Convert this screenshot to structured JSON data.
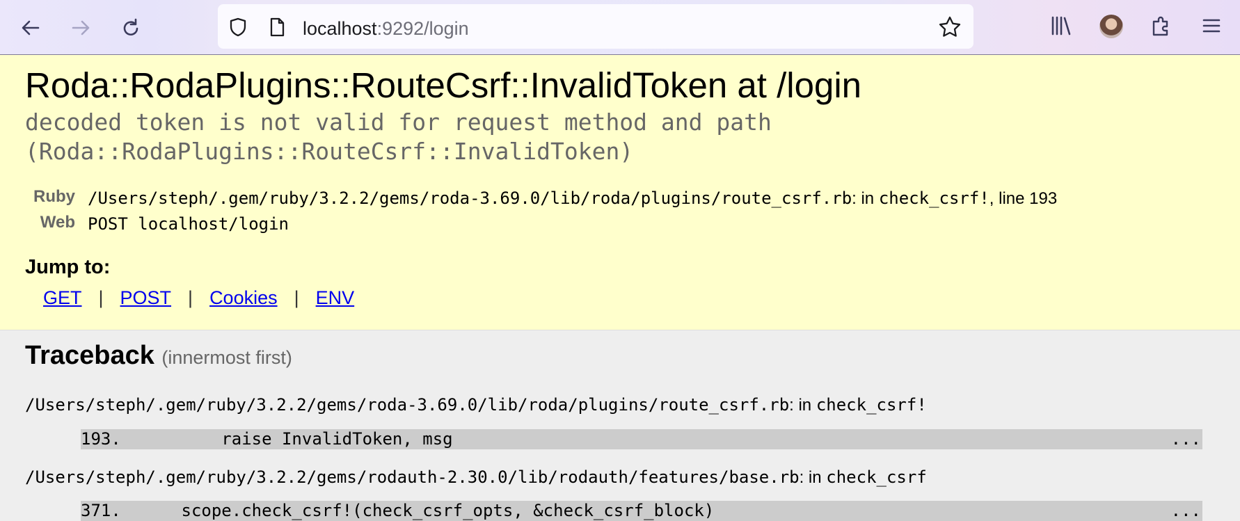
{
  "browser": {
    "url_host": "localhost",
    "url_rest": ":9292/login"
  },
  "error": {
    "title": "Roda::RodaPlugins::RouteCsrf::InvalidToken at /login",
    "message": "decoded token is not valid for request method and path\n(Roda::RodaPlugins::RouteCsrf::InvalidToken)",
    "ruby_label": "Ruby",
    "ruby_path": "/Users/steph/.gem/ruby/3.2.2/gems/roda-3.69.0/lib/roda/plugins/route_csrf.rb",
    "ruby_in": ": in ",
    "ruby_method": "check_csrf!",
    "ruby_line": ", line 193",
    "web_label": "Web",
    "web_value": "POST localhost/login"
  },
  "jump": {
    "title": "Jump to:",
    "links": [
      "GET",
      "POST",
      "Cookies",
      "ENV"
    ],
    "separator": "|"
  },
  "traceback": {
    "title": "Traceback",
    "subtitle": "(innermost first)",
    "frames": [
      {
        "path": "/Users/steph/.gem/ruby/3.2.2/gems/roda-3.69.0/lib/roda/plugins/route_csrf.rb",
        "in_text": ": in ",
        "method": "check_csrf!",
        "line_no": "193.",
        "code": "          raise InvalidToken, msg",
        "more": "..."
      },
      {
        "path": "/Users/steph/.gem/ruby/3.2.2/gems/rodauth-2.30.0/lib/rodauth/features/base.rb",
        "in_text": ": in ",
        "method": "check_csrf",
        "line_no": "371.",
        "code": "      scope.check_csrf!(check_csrf_opts, &check_csrf_block)",
        "more": "..."
      }
    ]
  }
}
